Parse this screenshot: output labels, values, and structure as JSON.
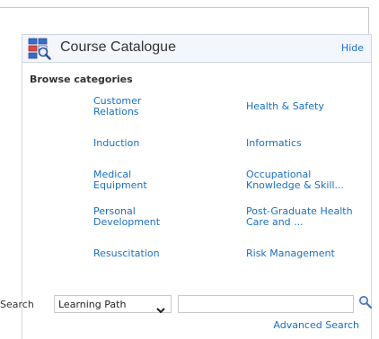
{
  "panel": {
    "title": "Course Catalogue",
    "hide_label": "Hide",
    "icon": "catalog-grid-search-icon"
  },
  "browse": {
    "label": "Browse categories",
    "categories": [
      "Customer Relations",
      "Health & Safety",
      "Induction",
      "Informatics",
      "Medical Equipment",
      "Occupational Knowledge & Skill...",
      "Personal Development",
      "Post-Graduate Health Care and ...",
      "Resuscitation",
      "Risk Management"
    ]
  },
  "search": {
    "label": "Search",
    "type_selected": "Learning Path",
    "input_value": "",
    "button_icon": "magnifier-icon",
    "advanced_label": "Advanced Search"
  },
  "colors": {
    "link": "#1a6fc1",
    "header_bg": "#f3f6fa",
    "icon_blue": "#3b6cc8",
    "icon_red": "#d94a4a"
  }
}
